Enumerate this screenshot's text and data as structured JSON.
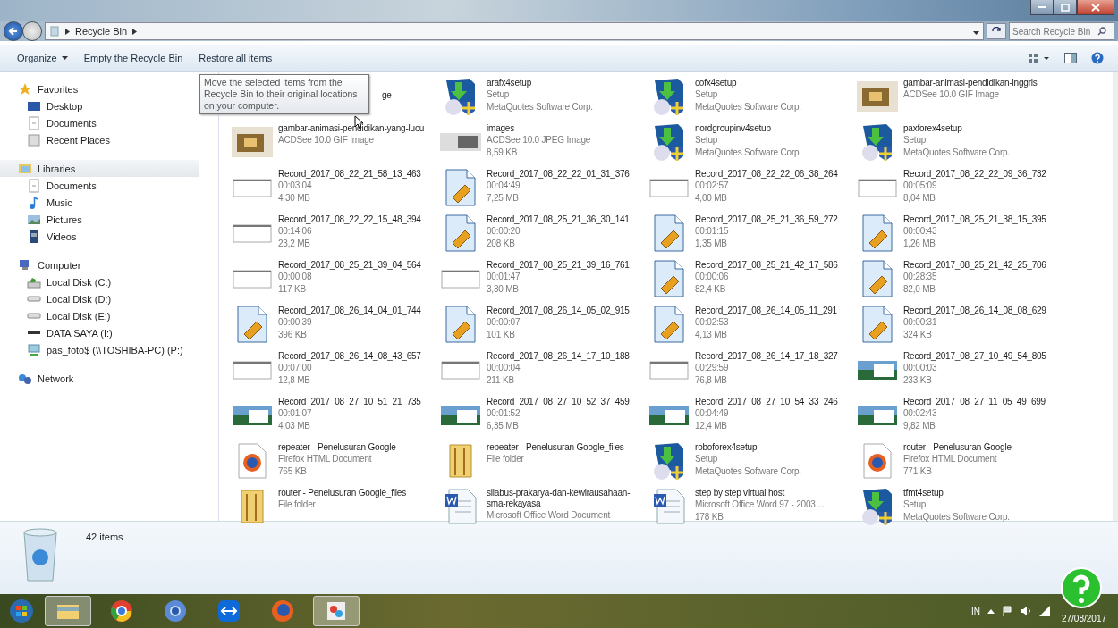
{
  "address": {
    "crumbs": [
      "Recycle Bin"
    ],
    "search_placeholder": "Search Recycle Bin"
  },
  "toolbar": {
    "buttons": [
      "Organize",
      "Empty the Recycle Bin",
      "Restore all items"
    ]
  },
  "tooltip": "Move the selected items from the Recycle Bin to their original locations on your computer.",
  "sidebar": [
    {
      "label": "Favorites",
      "kind": "favorites",
      "selected": false,
      "children": [
        {
          "label": "Desktop",
          "kind": "desktop",
          "selected": false
        },
        {
          "label": "Documents",
          "kind": "doc",
          "selected": false
        },
        {
          "label": "Recent Places",
          "kind": "recent",
          "selected": false
        }
      ]
    },
    {
      "label": "Libraries",
      "kind": "libraries",
      "selected": true,
      "children": [
        {
          "label": "Documents",
          "kind": "doc",
          "selected": false
        },
        {
          "label": "Music",
          "kind": "music",
          "selected": false
        },
        {
          "label": "Pictures",
          "kind": "pictures",
          "selected": false
        },
        {
          "label": "Videos",
          "kind": "videos",
          "selected": false
        }
      ]
    },
    {
      "label": "Computer",
      "kind": "computer",
      "selected": false,
      "children": [
        {
          "label": "Local Disk (C:)",
          "kind": "sysdisk",
          "selected": false
        },
        {
          "label": "Local Disk (D:)",
          "kind": "disk",
          "selected": false
        },
        {
          "label": "Local Disk (E:)",
          "kind": "disk",
          "selected": false
        },
        {
          "label": "DATA SAYA (I:)",
          "kind": "usb",
          "selected": false
        },
        {
          "label": "pas_foto$ (\\\\TOSHIBA-PC) (P:)",
          "kind": "netdrive",
          "selected": false
        }
      ]
    },
    {
      "label": "Network",
      "kind": "network",
      "selected": false
    }
  ],
  "items": [
    {
      "kind": "covered",
      "lines": [
        "ge"
      ]
    },
    {
      "kind": "setup",
      "lines": [
        "arafx4setup",
        "Setup",
        "MetaQuotes Software Corp."
      ]
    },
    {
      "kind": "setup",
      "lines": [
        "cofx4setup",
        "Setup",
        "MetaQuotes Software Corp."
      ]
    },
    {
      "kind": "gif",
      "lines": [
        "gambar-animasi-pendidikan-inggris",
        "ACDSee 10.0 GIF Image"
      ]
    },
    {
      "kind": "gif",
      "lines": [
        "gambar-animasi-pendidikan-yang-lucu",
        "ACDSee 10.0 GIF Image"
      ]
    },
    {
      "kind": "jpeg",
      "lines": [
        "images",
        "ACDSee 10.0 JPEG Image",
        "8,59 KB"
      ]
    },
    {
      "kind": "setup",
      "lines": [
        "nordgroupinv4setup",
        "Setup",
        "MetaQuotes Software Corp."
      ]
    },
    {
      "kind": "setup",
      "lines": [
        "paxforex4setup",
        "Setup",
        "MetaQuotes Software Corp."
      ]
    },
    {
      "kind": "video",
      "lines": [
        "Record_2017_08_22_21_58_13_463",
        "00:03:04",
        "4,30 MB"
      ]
    },
    {
      "kind": "audio",
      "lines": [
        "Record_2017_08_22_22_01_31_376",
        "00:04:49",
        "7,25 MB"
      ]
    },
    {
      "kind": "video",
      "lines": [
        "Record_2017_08_22_22_06_38_264",
        "00:02:57",
        "4,00 MB"
      ]
    },
    {
      "kind": "video",
      "lines": [
        "Record_2017_08_22_22_09_36_732",
        "00:05:09",
        "8,04 MB"
      ]
    },
    {
      "kind": "video",
      "lines": [
        "Record_2017_08_22_22_15_48_394",
        "00:14:06",
        "23,2 MB"
      ]
    },
    {
      "kind": "audio",
      "lines": [
        "Record_2017_08_25_21_36_30_141",
        "00:00:20",
        "208 KB"
      ]
    },
    {
      "kind": "audio",
      "lines": [
        "Record_2017_08_25_21_36_59_272",
        "00:01:15",
        "1,35 MB"
      ]
    },
    {
      "kind": "audio",
      "lines": [
        "Record_2017_08_25_21_38_15_395",
        "00:00:43",
        "1,26 MB"
      ]
    },
    {
      "kind": "video",
      "lines": [
        "Record_2017_08_25_21_39_04_564",
        "00:00:08",
        "117 KB"
      ]
    },
    {
      "kind": "video",
      "lines": [
        "Record_2017_08_25_21_39_16_761",
        "00:01:47",
        "3,30 MB"
      ]
    },
    {
      "kind": "audio",
      "lines": [
        "Record_2017_08_25_21_42_17_586",
        "00:00:06",
        "82,4 KB"
      ]
    },
    {
      "kind": "audio",
      "lines": [
        "Record_2017_08_25_21_42_25_706",
        "00:28:35",
        "82,0 MB"
      ]
    },
    {
      "kind": "audio",
      "lines": [
        "Record_2017_08_26_14_04_01_744",
        "00:00:39",
        "396 KB"
      ]
    },
    {
      "kind": "audio",
      "lines": [
        "Record_2017_08_26_14_05_02_915",
        "00:00:07",
        "101 KB"
      ]
    },
    {
      "kind": "audio",
      "lines": [
        "Record_2017_08_26_14_05_11_291",
        "00:02:53",
        "4,13 MB"
      ]
    },
    {
      "kind": "audio",
      "lines": [
        "Record_2017_08_26_14_08_08_629",
        "00:00:31",
        "324 KB"
      ]
    },
    {
      "kind": "video",
      "lines": [
        "Record_2017_08_26_14_08_43_657",
        "00:07:00",
        "12,8 MB"
      ]
    },
    {
      "kind": "video",
      "lines": [
        "Record_2017_08_26_14_17_10_188",
        "00:00:04",
        "211 KB"
      ]
    },
    {
      "kind": "video",
      "lines": [
        "Record_2017_08_26_14_17_18_327",
        "00:29:59",
        "76,8 MB"
      ]
    },
    {
      "kind": "thumb",
      "lines": [
        "Record_2017_08_27_10_49_54_805",
        "00:00:03",
        "233 KB"
      ]
    },
    {
      "kind": "thumb",
      "lines": [
        "Record_2017_08_27_10_51_21_735",
        "00:01:07",
        "4,03 MB"
      ]
    },
    {
      "kind": "thumb",
      "lines": [
        "Record_2017_08_27_10_52_37_459",
        "00:01:52",
        "6,35 MB"
      ]
    },
    {
      "kind": "thumb",
      "lines": [
        "Record_2017_08_27_10_54_33_246",
        "00:04:49",
        "12,4 MB"
      ]
    },
    {
      "kind": "thumb",
      "lines": [
        "Record_2017_08_27_11_05_49_699",
        "00:02:43",
        "9,82 MB"
      ]
    },
    {
      "kind": "html",
      "lines": [
        "repeater - Penelusuran Google",
        "Firefox HTML Document",
        "765 KB"
      ]
    },
    {
      "kind": "folder",
      "lines": [
        "repeater - Penelusuran Google_files",
        "File folder"
      ]
    },
    {
      "kind": "setup",
      "lines": [
        "roboforex4setup",
        "Setup",
        "MetaQuotes Software Corp."
      ]
    },
    {
      "kind": "html",
      "lines": [
        "router - Penelusuran Google",
        "Firefox HTML Document",
        "771 KB"
      ]
    },
    {
      "kind": "folder",
      "lines": [
        "router - Penelusuran Google_files",
        "File folder"
      ]
    },
    {
      "kind": "word",
      "lines": [
        "silabus-prakarya-dan-kewirausahaan-sma-rekayasa",
        "Microsoft Office Word Document"
      ]
    },
    {
      "kind": "word",
      "lines": [
        "step by step virtual host",
        "Microsoft Office Word 97 - 2003 ...",
        "178 KB"
      ]
    },
    {
      "kind": "setup",
      "lines": [
        "tfmt4setup",
        "Setup",
        "MetaQuotes Software Corp."
      ]
    }
  ],
  "details": {
    "count": "42 items"
  },
  "taskbar": {
    "apps": [
      {
        "kind": "explorer",
        "selected": true
      },
      {
        "kind": "chrome",
        "selected": false
      },
      {
        "kind": "chromium",
        "selected": false
      },
      {
        "kind": "teamviewer",
        "selected": false
      },
      {
        "kind": "firefox",
        "selected": false
      },
      {
        "kind": "paint",
        "selected": true
      }
    ],
    "language": "IN",
    "date": "27/08/2017"
  }
}
